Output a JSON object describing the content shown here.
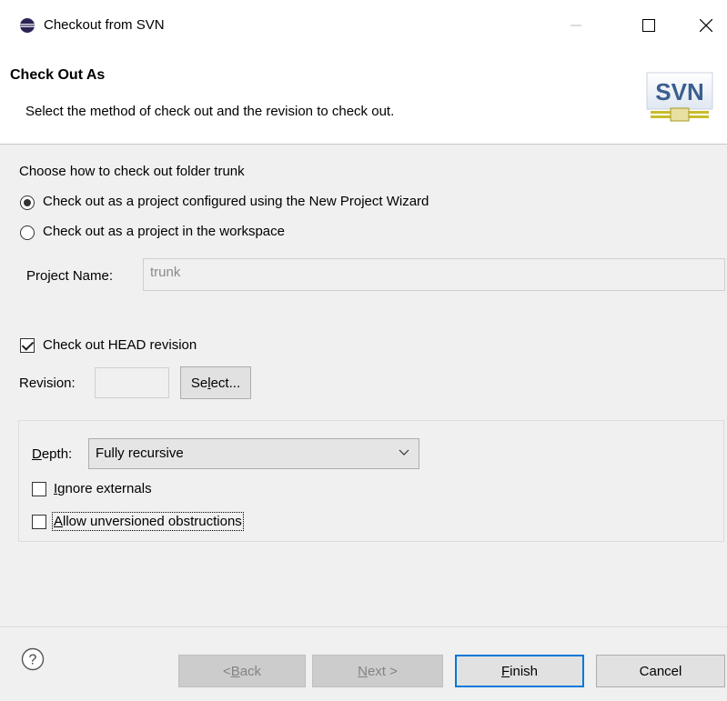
{
  "window": {
    "title": "Checkout from SVN",
    "icons": [
      "eclipse-icon",
      "minimize-icon",
      "maximize-icon",
      "close-icon"
    ]
  },
  "header": {
    "title": "Check Out As",
    "description": "Select the method of check out and the revision to check out.",
    "logo_text": "SVN"
  },
  "checkout": {
    "prompt": "Choose how to check out folder trunk",
    "options": [
      {
        "label": "Check out as a project configured using the New Project Wizard",
        "selected": true
      },
      {
        "label": "Check out as a project in the workspace",
        "selected": false
      }
    ],
    "project_name_label": "Project Name:",
    "project_name_value": "trunk"
  },
  "revision": {
    "head_label": "Check out HEAD revision",
    "head_checked": true,
    "revision_label": "Revision:",
    "revision_value": "",
    "select_pre": "Se",
    "select_mnemonic": "l",
    "select_post": "ect..."
  },
  "depth": {
    "label_mnemonic": "D",
    "label_rest": "epth:",
    "value": "Fully recursive",
    "ignore_mnemonic": "I",
    "ignore_rest": "gnore externals",
    "ignore_checked": false,
    "allow_mnemonic": "A",
    "allow_rest": "llow unversioned obstructions",
    "allow_checked": false
  },
  "footer": {
    "help_icon": "help-icon",
    "back_pre": "< ",
    "back_mnemonic": "B",
    "back_rest": "ack",
    "next_mnemonic": "N",
    "next_rest": "ext >",
    "finish_mnemonic": "F",
    "finish_rest": "inish",
    "cancel_label": "Cancel"
  }
}
